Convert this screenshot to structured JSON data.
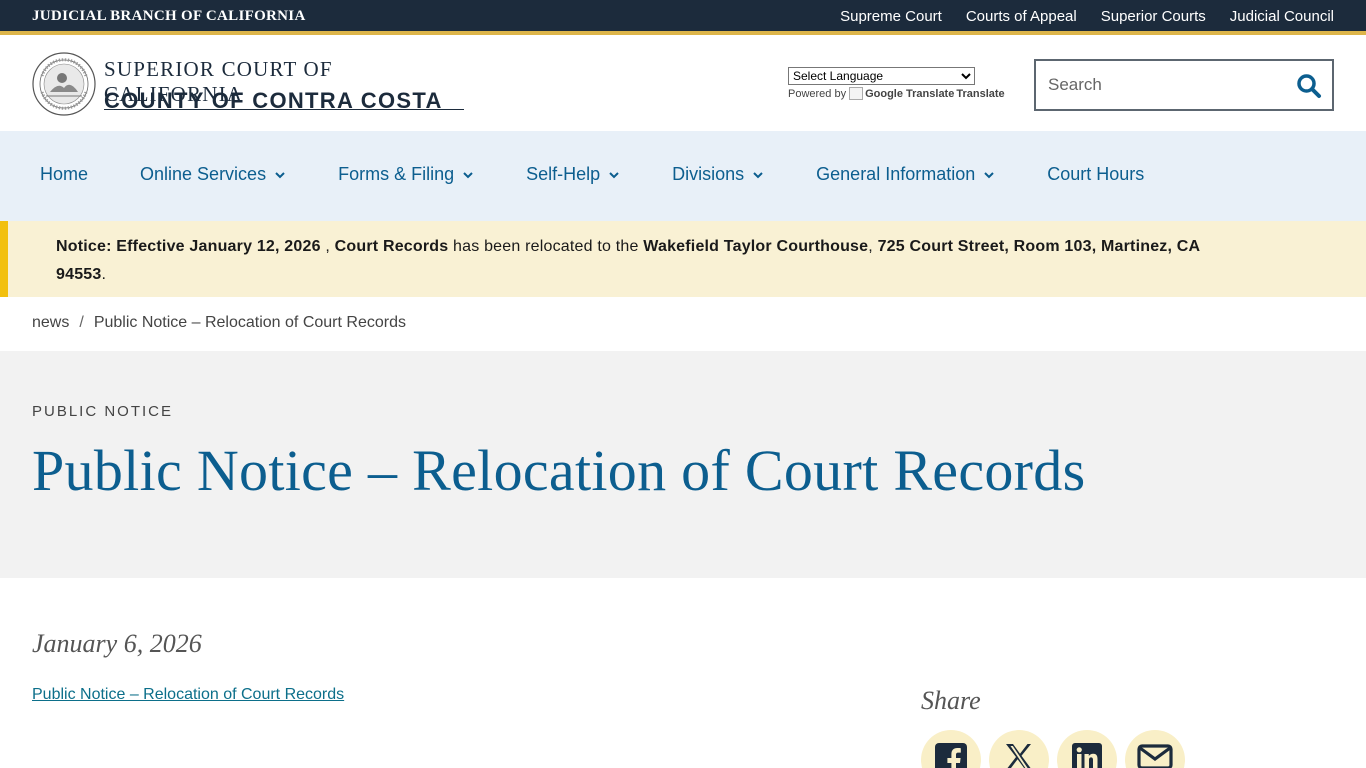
{
  "topbar": {
    "title": "JUDICIAL BRANCH OF CALIFORNIA",
    "links": [
      "Supreme Court",
      "Courts of Appeal",
      "Superior Courts",
      "Judicial Council"
    ]
  },
  "header": {
    "brand_line1": "SUPERIOR COURT OF CALIFORNIA",
    "brand_line2": "COUNTY OF CONTRA COSTA",
    "translate_select": "Select Language",
    "powered_by": "Powered by",
    "google_translate_alt": "Google Translate",
    "translate_label": "Translate",
    "search_placeholder": "Search"
  },
  "nav": {
    "items": [
      {
        "label": "Home"
      },
      {
        "label": "Online Services"
      },
      {
        "label": "Forms & Filing"
      },
      {
        "label": "Self-Help"
      },
      {
        "label": "Divisions"
      },
      {
        "label": "General Information"
      },
      {
        "label": "Court Hours"
      }
    ]
  },
  "alert": {
    "prefix": "Notice: Effective January 12, 2026",
    "mid1": " , ",
    "records": "Court Records",
    "mid2": " has been relocated to the ",
    "courthouse": "Wakefield Taylor Courthouse",
    "mid3": ", ",
    "address": "725 Court Street, Room 103, Martinez, CA 94553",
    "suffix": "."
  },
  "breadcrumb": {
    "home": "news",
    "separator": "/",
    "current": "Public Notice – Relocation of Court Records"
  },
  "hero": {
    "eyebrow": "PUBLIC NOTICE",
    "title": "Public Notice – Relocation of Court Records"
  },
  "article": {
    "date": "January 6, 2026",
    "link": "Public Notice – Relocation of Court Records"
  },
  "share": {
    "label": "Share",
    "icons": [
      "facebook-icon",
      "x-icon",
      "linkedin-icon",
      "email-icon"
    ]
  },
  "colors": {
    "topbar_bg": "#1c2b3c",
    "accent_gold": "#ddb54a",
    "nav_bg": "#e8f0f8",
    "link_blue": "#0c5e8f",
    "alert_bg": "#f9f1d4",
    "alert_border": "#f2c00e",
    "hero_bg": "#f2f2f2"
  }
}
